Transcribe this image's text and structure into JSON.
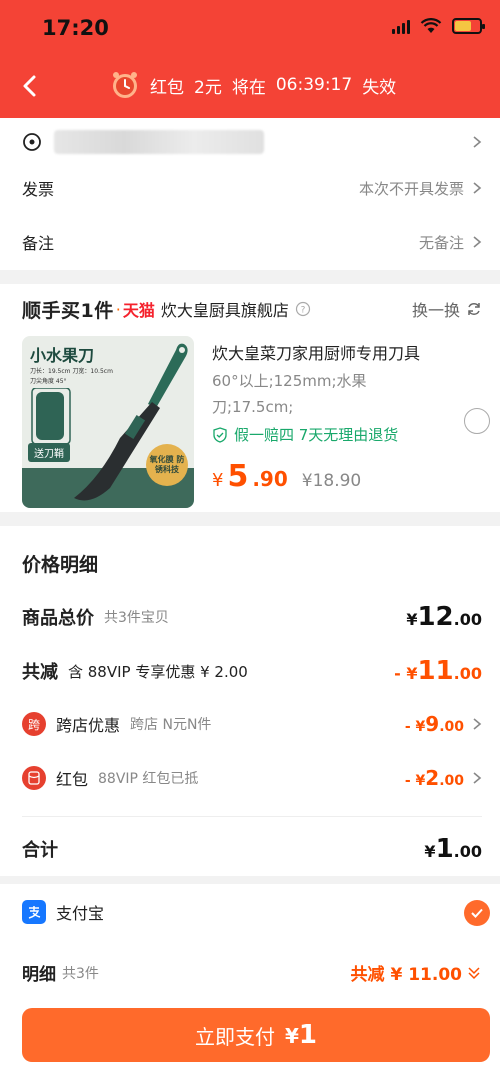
{
  "status_bar": {
    "time": "17:20"
  },
  "banner": {
    "prefix": "红包",
    "amount": "2元",
    "middle": "将在",
    "countdown": "06:39:17",
    "suffix": "失效"
  },
  "address": {
    "invoice_label": "发票",
    "invoice_value": "本次不开具发票",
    "remark_label": "备注",
    "remark_value": "无备注"
  },
  "product": {
    "brand_tag": "顺手买1件",
    "dot": "·",
    "platform": "天猫",
    "shop_name": "炊大皇厨具旗舰店",
    "swap_label": "换一换",
    "title": "炊大皇菜刀家用厨师专用刀具",
    "spec": "60°以上;125mm;水果刀;17.5cm;",
    "guarantee": "假一赔四 7天无理由退货",
    "price_yen": "¥",
    "price_int": "5",
    "price_dec": ".90",
    "original_price": "¥18.90",
    "thumb": {
      "label": "小水果刀",
      "spec1": "刀长：19.5cm 刀宽：10.5cm",
      "spec2": "刀尖角度 45°",
      "send": "送刀鞘",
      "badge": "氧化膜 防锈科技"
    }
  },
  "details": {
    "title": "价格明细",
    "total": {
      "label": "商品总价",
      "sub": "共3件宝贝",
      "yen": "¥",
      "int": "12",
      "dec": ".00"
    },
    "reduce": {
      "label": "共减",
      "sub": "含 88VIP 专享优惠 ¥ 2.00",
      "yen": "- ¥",
      "int": "11",
      "dec": ".00"
    },
    "cross_store": {
      "icon_text": "跨",
      "label": "跨店优惠",
      "sub": "跨店 N元N件",
      "yen": "- ¥",
      "int": "9",
      "dec": ".00"
    },
    "red_packet": {
      "label": "红包",
      "sub": "88VIP 红包已抵",
      "yen": "- ¥",
      "int": "2",
      "dec": ".00"
    },
    "sum": {
      "label": "合计",
      "yen": "¥",
      "int": "1",
      "dec": ".00"
    }
  },
  "payment": {
    "method": "支付宝",
    "detail_label": "明细",
    "detail_count": "共3件",
    "detail_reduce": "共减 ¥ 11.00",
    "pay_button": "立即支付",
    "pay_yen": "¥",
    "pay_amount": "1"
  },
  "colors": {
    "header": "#f44336",
    "accent": "#ff5000",
    "pay_button": "#ff6a2b",
    "guarantee": "#19a86b"
  }
}
